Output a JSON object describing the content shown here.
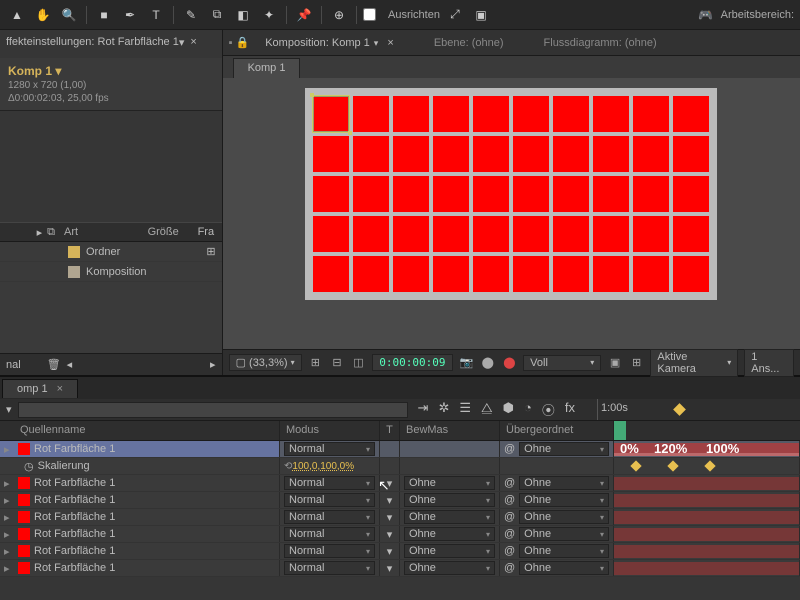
{
  "toolbar": {
    "align_label": "Ausrichten",
    "workspace_label": "Arbeitsbereich:"
  },
  "effect_panel": {
    "title": "ffekteinstellungen: Rot Farbfläche 1"
  },
  "project": {
    "title": "Komp 1 ▾",
    "meta1": "1280 x 720 (1,00)",
    "meta2": "Δ0:00:02:03, 25,00 fps",
    "cols": {
      "name": "Art",
      "size": "Größe",
      "fr": "Fra"
    },
    "items": [
      {
        "name": "Ordner",
        "color": "#d6b45a"
      },
      {
        "name": "Komposition",
        "color": "#b0a590"
      }
    ],
    "footer": "nal"
  },
  "comp_tabs": {
    "main": "Komposition: Komp 1",
    "layer": "Ebene: (ohne)",
    "flow": "Flussdiagramm: (ohne)",
    "sub": "Komp 1"
  },
  "viewer_ctrl": {
    "zoom": "(33,3%)",
    "tc": "0:00:00:09",
    "mode": "Voll",
    "camera": "Aktive Kamera",
    "views": "1 Ans..."
  },
  "timeline": {
    "tab": "omp 1",
    "ruler": "1:00s",
    "headers": {
      "name": "Quellenname",
      "mode": "Modus",
      "t": "T",
      "bew": "BewMas",
      "ueber": "Übergeordnet"
    },
    "layers": [
      {
        "name": "Rot Farbfläche 1",
        "mode": "Normal",
        "bew": "",
        "ueber": "Ohne",
        "sel": true
      },
      {
        "name": "Skalierung",
        "mode": "",
        "val": "100,0,100,0%",
        "sub": true
      },
      {
        "name": "Rot Farbfläche 1",
        "mode": "Normal",
        "bew": "Ohne",
        "ueber": "Ohne"
      },
      {
        "name": "Rot Farbfläche 1",
        "mode": "Normal",
        "bew": "Ohne",
        "ueber": "Ohne"
      },
      {
        "name": "Rot Farbfläche 1",
        "mode": "Normal",
        "bew": "Ohne",
        "ueber": "Ohne"
      },
      {
        "name": "Rot Farbfläche 1",
        "mode": "Normal",
        "bew": "Ohne",
        "ueber": "Ohne"
      },
      {
        "name": "Rot Farbfläche 1",
        "mode": "Normal",
        "bew": "Ohne",
        "ueber": "Ohne"
      },
      {
        "name": "Rot Farbfläche 1",
        "mode": "Normal",
        "bew": "Ohne",
        "ueber": "Ohne"
      }
    ],
    "kf_labels": [
      "0%",
      "120%",
      "100%"
    ]
  }
}
